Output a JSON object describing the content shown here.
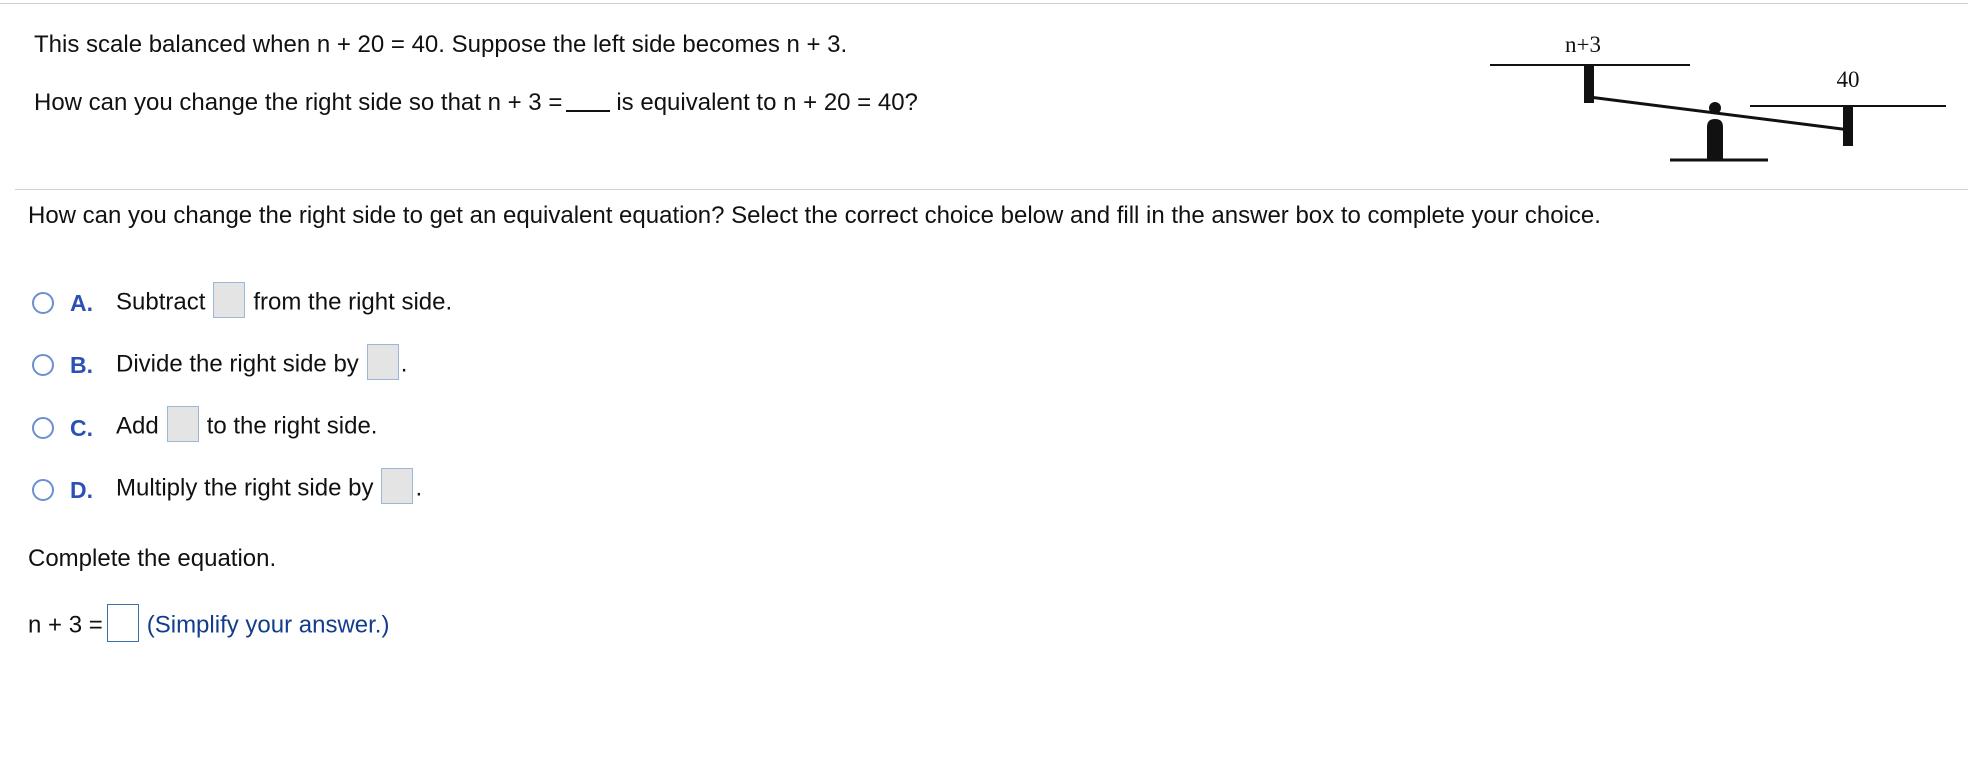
{
  "problem": {
    "line1": "This scale balanced when n + 20 = 40. Suppose the left side becomes n + 3.",
    "line2_pre": "How can you change the right side so that n + 3 =",
    "line2_post": "is equivalent to n + 20 = 40?"
  },
  "scale": {
    "left_label": "n+3",
    "right_label": "40"
  },
  "question": "How can you change the right side to get an equivalent equation? Select the correct choice below and fill in the answer box to complete your choice.",
  "choices": [
    {
      "letter": "A.",
      "pre": "Subtract",
      "post": "from the right side."
    },
    {
      "letter": "B.",
      "pre": "Divide the right side by",
      "post": "."
    },
    {
      "letter": "C.",
      "pre": "Add",
      "post": "to the right side."
    },
    {
      "letter": "D.",
      "pre": "Multiply the right side by",
      "post": "."
    }
  ],
  "complete": {
    "prompt": "Complete the equation.",
    "lhs": "n + 3 =",
    "hint": "(Simplify your answer.)"
  },
  "colors": {
    "radio_border": "#6b8fd0",
    "choice_letter": "#2b51b5",
    "hint_text": "#123c8c"
  }
}
